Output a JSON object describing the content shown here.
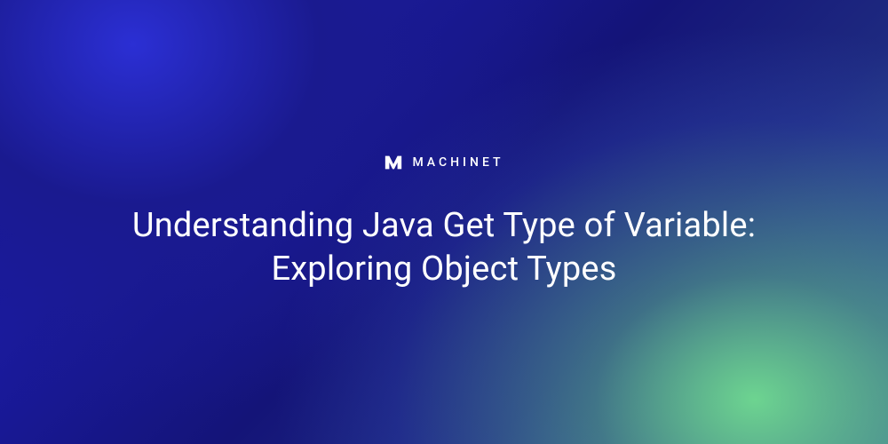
{
  "brand": {
    "name": "MACHINET",
    "icon": "machinet-logo-icon"
  },
  "hero": {
    "title": "Understanding Java Get Type of Variable: Exploring Object Types"
  },
  "colors": {
    "text": "#ffffff",
    "gradient_start": "#1414b2",
    "gradient_accent": "#6dd490"
  }
}
